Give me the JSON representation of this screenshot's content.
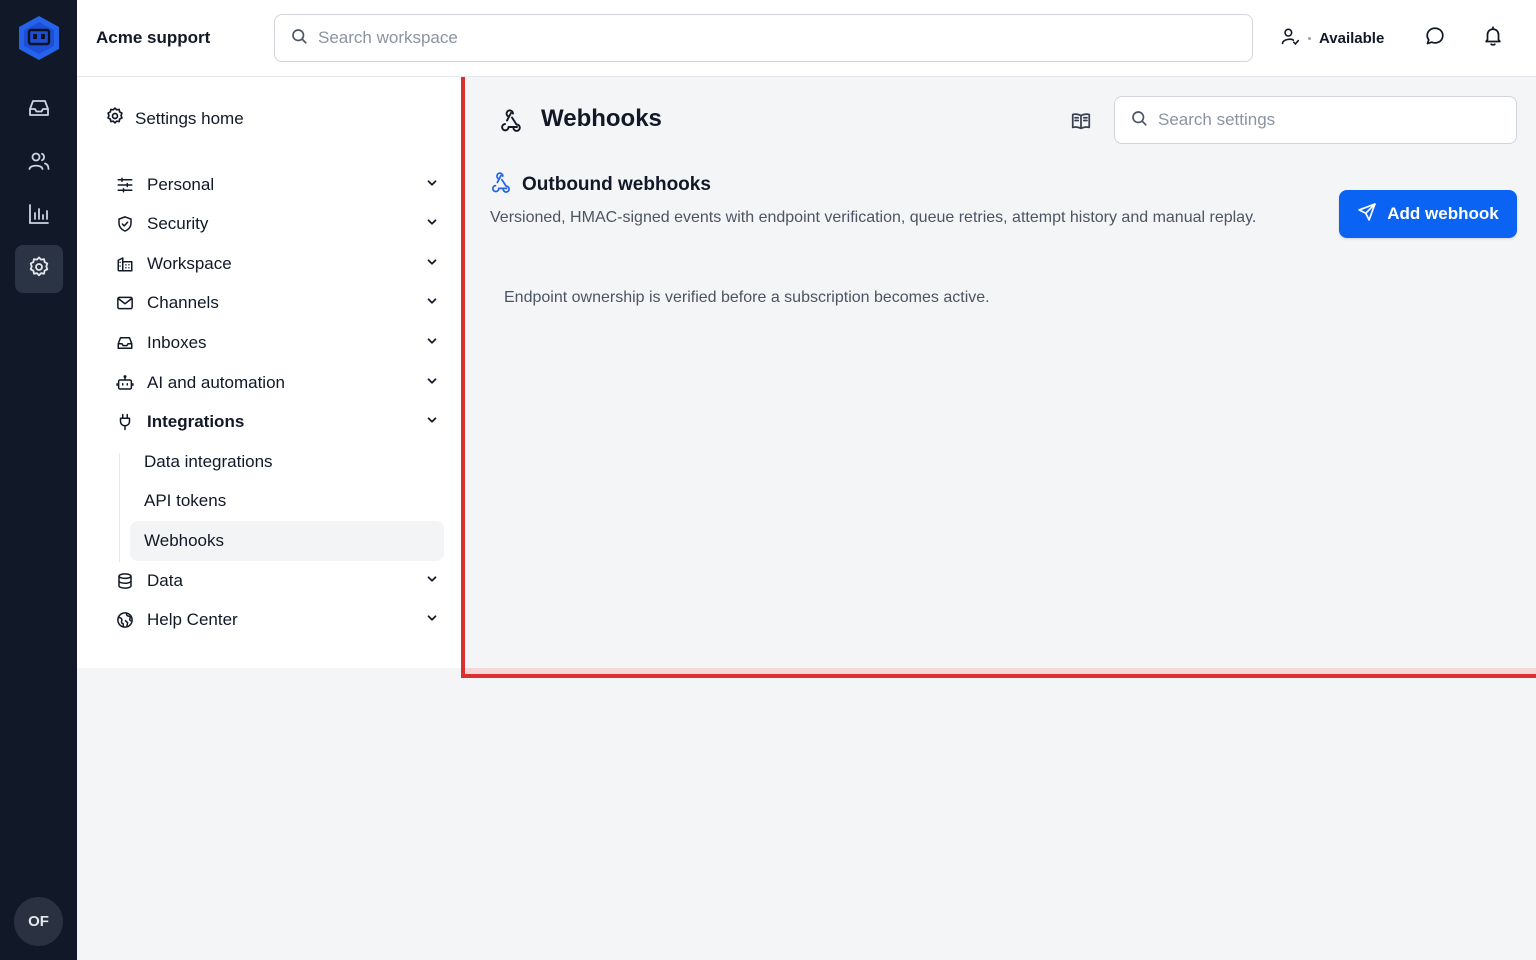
{
  "app": {
    "org_name": "Acme support",
    "user_initials": "OF",
    "brand_color": "#2563eb"
  },
  "rail": {
    "items": [
      {
        "name": "inbox-icon"
      },
      {
        "name": "contacts-icon"
      },
      {
        "name": "reports-icon"
      },
      {
        "name": "settings-icon",
        "active": true
      }
    ]
  },
  "topbar": {
    "search_placeholder": "Search workspace",
    "status_label": "Available"
  },
  "sidebar": {
    "home_label": "Settings home",
    "items": [
      {
        "label": "Personal",
        "icon": "sliders-icon"
      },
      {
        "label": "Security",
        "icon": "shield-icon"
      },
      {
        "label": "Workspace",
        "icon": "building-icon"
      },
      {
        "label": "Channels",
        "icon": "mail-icon"
      },
      {
        "label": "Inboxes",
        "icon": "inbox-icon"
      },
      {
        "label": "AI and automation",
        "icon": "bot-icon"
      },
      {
        "label": "Integrations",
        "icon": "plug-icon",
        "expanded": true
      },
      {
        "label": "Data",
        "icon": "database-icon"
      },
      {
        "label": "Help Center",
        "icon": "globe-icon"
      }
    ],
    "integrations_children": [
      {
        "label": "Data integrations"
      },
      {
        "label": "API tokens"
      },
      {
        "label": "Webhooks",
        "active": true
      }
    ]
  },
  "main": {
    "title": "Webhooks",
    "search_placeholder": "Search settings",
    "section": {
      "title": "Outbound webhooks",
      "description": "Versioned, HMAC-signed events with endpoint verification, queue retries, attempt history and manual replay.",
      "button_label": "Add webhook",
      "note": "Endpoint ownership is verified before a subscription becomes active."
    },
    "accent_color": "#0b63f3",
    "highlight_color": "#dc2f34"
  }
}
